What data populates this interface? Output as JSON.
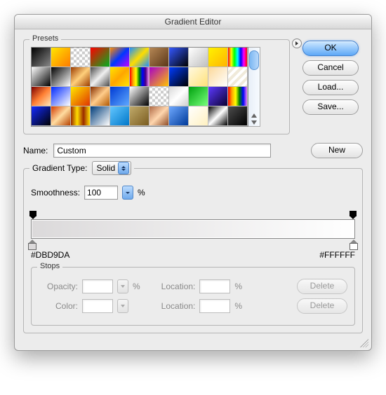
{
  "window": {
    "title": "Gradient Editor"
  },
  "buttons": {
    "ok": "OK",
    "cancel": "Cancel",
    "load": "Load...",
    "save": "Save...",
    "new": "New",
    "delete": "Delete"
  },
  "presets": {
    "legend": "Presets",
    "swatches": [
      "linear-gradient(135deg,#000,#888)",
      "linear-gradient(135deg,#ffe600,#ff7a00)",
      "repeating-conic-gradient(#ccc 0 25%,#fff 0 50%) 0/8px 8px",
      "linear-gradient(135deg,#ff0000,#00b11f)",
      "linear-gradient(135deg,#ff8a00,#0037ff,#c400ff)",
      "linear-gradient(135deg,#1e90ff,#ffdd00,#1e90ff)",
      "linear-gradient(135deg,#b58755,#5a3617)",
      "linear-gradient(135deg,#3458ff,#000)",
      "linear-gradient(135deg,#fff,#bfbfbf)",
      "linear-gradient(135deg,#fff200,#ffb400)",
      "linear-gradient(90deg,#ff0000,#ffff00,#00ff00,#00ffff,#0000ff,#ff00ff,#ff0000)",
      "linear-gradient(135deg,#fff,#000)",
      "linear-gradient(135deg,#000,#fff)",
      "linear-gradient(135deg,#9b3c00,#ffcf7b,#9b3c00)",
      "linear-gradient(135deg,#4d4d4d,#f0f0f0,#4d4d4d)",
      "linear-gradient(135deg,#ffe400,#ffa600,#ffe400)",
      "linear-gradient(90deg,red,orange,yellow,green,blue,indigo,violet)",
      "linear-gradient(135deg,#a800c7,#ffc300)",
      "linear-gradient(135deg,#003cff,#000)",
      "linear-gradient(135deg,#fff9e0,#ffe17a)",
      "linear-gradient(135deg,#fcd89a,#fff)",
      "repeating-linear-gradient(135deg,#fff 0 4px,#f0eada 4px 8px)",
      "linear-gradient(135deg,#7c0000,#ff7f33,#ffe8b8)",
      "linear-gradient(135deg,#002aff,#fff)",
      "linear-gradient(135deg,#ffe600,#e03400)",
      "linear-gradient(135deg,#862f00,#ffcc8a,#b25800)",
      "linear-gradient(135deg,#003bd4,#5fa8ff)",
      "linear-gradient(135deg,#fff,#000)",
      "repeating-conic-gradient(#ccc 0 25%,#fff 0 50%) 0/8px 8px",
      "linear-gradient(135deg,#d9d9d9,#fff,#cfcfcf)",
      "linear-gradient(135deg,#00a10e,#76ff7a)",
      "linear-gradient(135deg,#5c3aff,#0b0033)",
      "linear-gradient(90deg,red,orange,yellow,green,blue,violet)",
      "linear-gradient(135deg,#132bff,#000)",
      "linear-gradient(135deg,#d43a00,#ffdca0,#b74300)",
      "linear-gradient(90deg,#9a2a00,#ffdd00,#9a2a00,#ffdd00)",
      "linear-gradient(135deg,#003d7a,#ffffff)",
      "linear-gradient(135deg,#62c6ff,#0077c9)",
      "linear-gradient(135deg,#c0aa6a,#7a5c20)",
      "linear-gradient(135deg,#b06a45,#ffd6ae,#8f4c27)",
      "linear-gradient(135deg,#6ea8ff,#003a99)",
      "linear-gradient(135deg,#ffffff,#fff1c0)",
      "linear-gradient(135deg,#000,#fff,#000)",
      "linear-gradient(135deg,#4d4d4d,#000)"
    ]
  },
  "name": {
    "label": "Name:",
    "value": "Custom"
  },
  "gradientType": {
    "legend": "Gradient Type:",
    "value": "Solid",
    "smoothnessLabel": "Smoothness:",
    "smoothnessValue": "100",
    "smoothnessUnit": "%"
  },
  "gradient": {
    "leftHex": "#DBD9DA",
    "rightHex": "#FFFFFF",
    "css": "linear-gradient(to right,#dbd9da 0%,#ffffff 100%)"
  },
  "stops": {
    "legend": "Stops",
    "opacityLabel": "Opacity:",
    "colorLabel": "Color:",
    "locationLabel": "Location:",
    "unit": "%"
  }
}
